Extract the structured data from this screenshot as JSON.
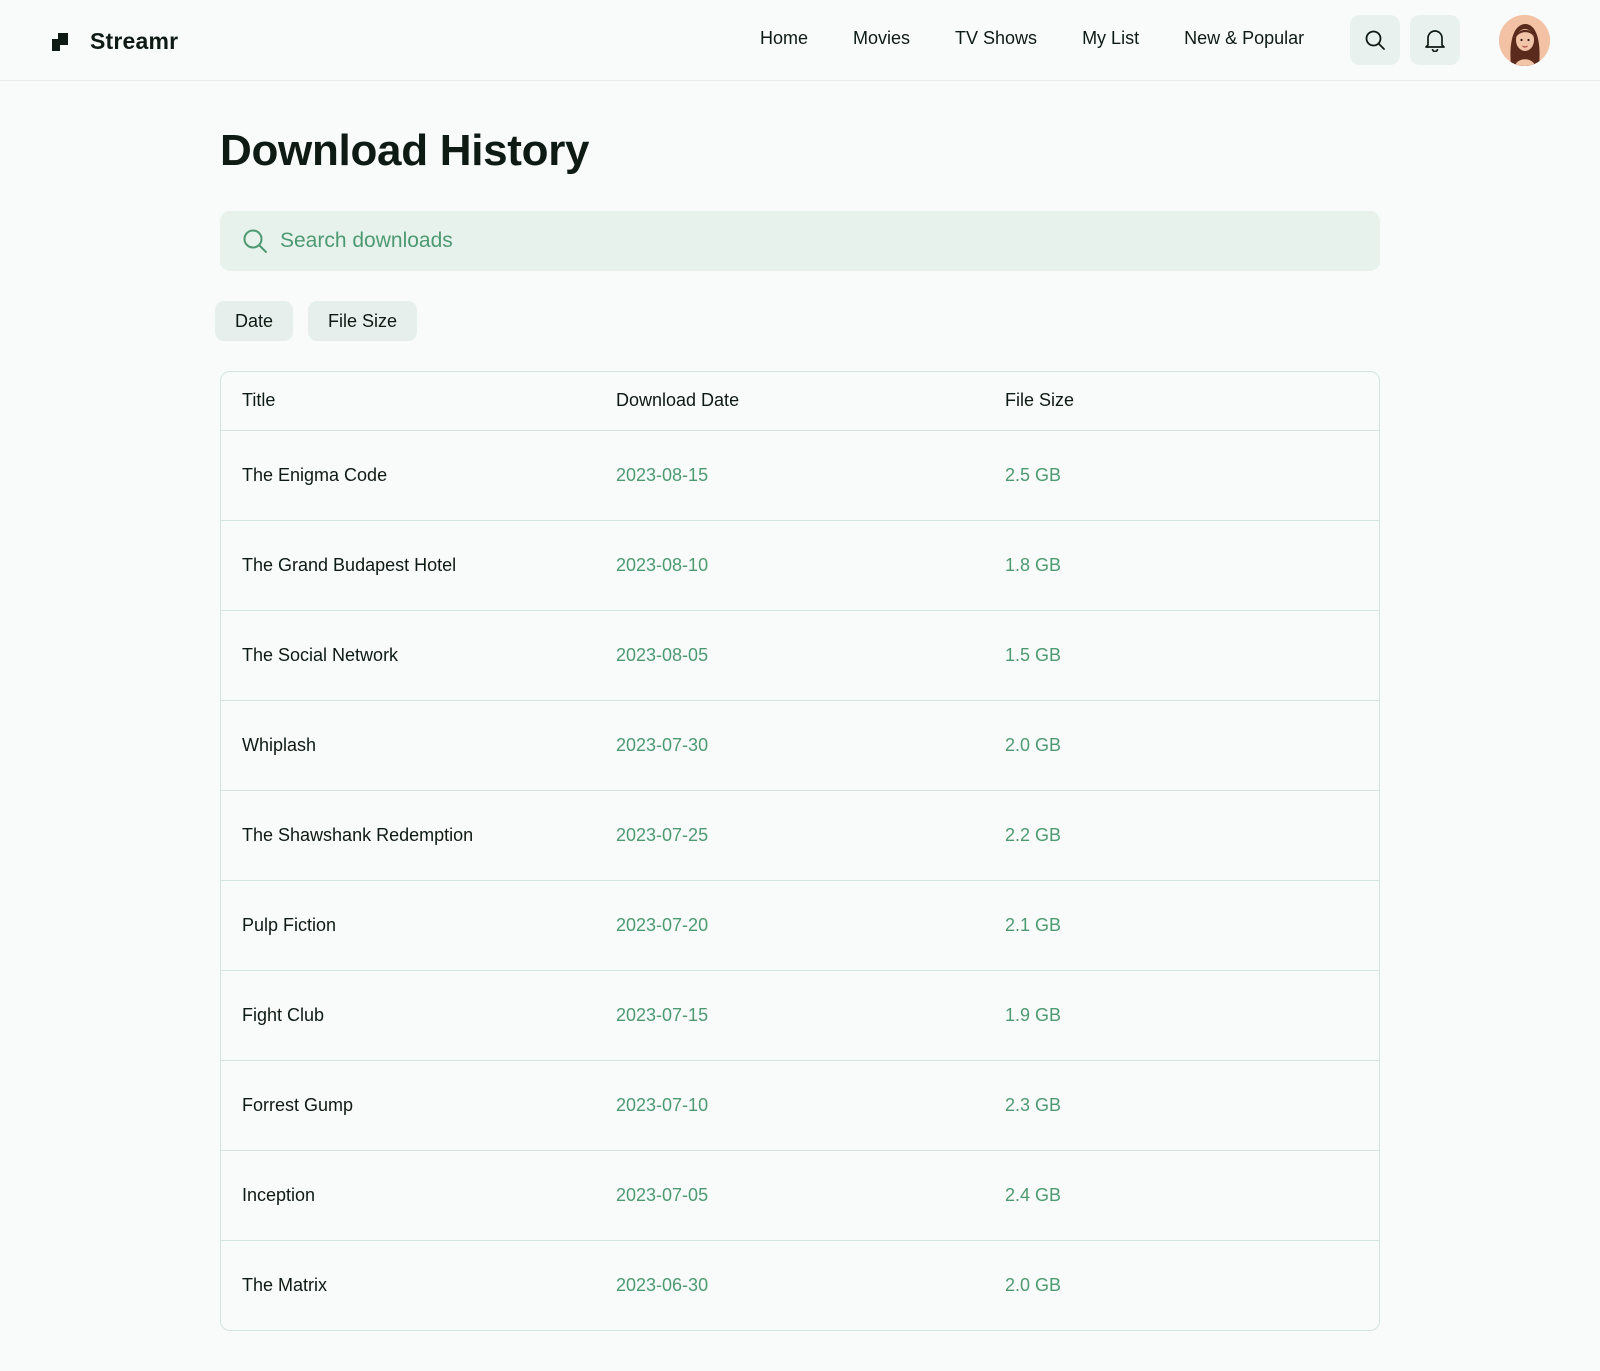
{
  "brand": {
    "name": "Streamr"
  },
  "nav": {
    "items": [
      {
        "label": "Home"
      },
      {
        "label": "Movies"
      },
      {
        "label": "TV Shows"
      },
      {
        "label": "My List"
      },
      {
        "label": "New & Popular"
      }
    ]
  },
  "header_icons": {
    "search": "search-icon",
    "notifications": "bell-icon"
  },
  "page": {
    "title": "Download History"
  },
  "search": {
    "placeholder": "Search downloads",
    "value": ""
  },
  "filters": [
    {
      "label": "Date"
    },
    {
      "label": "File Size"
    }
  ],
  "table": {
    "columns": [
      "Title",
      "Download Date",
      "File Size"
    ],
    "rows": [
      {
        "title": "The Enigma Code",
        "date": "2023-08-15",
        "size": "2.5 GB"
      },
      {
        "title": "The Grand Budapest Hotel",
        "date": "2023-08-10",
        "size": "1.8 GB"
      },
      {
        "title": "The Social Network",
        "date": "2023-08-05",
        "size": "1.5 GB"
      },
      {
        "title": "Whiplash",
        "date": "2023-07-30",
        "size": "2.0 GB"
      },
      {
        "title": "The Shawshank Redemption",
        "date": "2023-07-25",
        "size": "2.2 GB"
      },
      {
        "title": "Pulp Fiction",
        "date": "2023-07-20",
        "size": "2.1 GB"
      },
      {
        "title": "Fight Club",
        "date": "2023-07-15",
        "size": "1.9 GB"
      },
      {
        "title": "Forrest Gump",
        "date": "2023-07-10",
        "size": "2.3 GB"
      },
      {
        "title": "Inception",
        "date": "2023-07-05",
        "size": "2.4 GB"
      },
      {
        "title": "The Matrix",
        "date": "2023-06-30",
        "size": "2.0 GB"
      }
    ]
  },
  "colors": {
    "accent": "#4d9a72",
    "background": "#f8fbfa",
    "chip_bg": "#e6efeb",
    "border": "#d3e5dc"
  }
}
